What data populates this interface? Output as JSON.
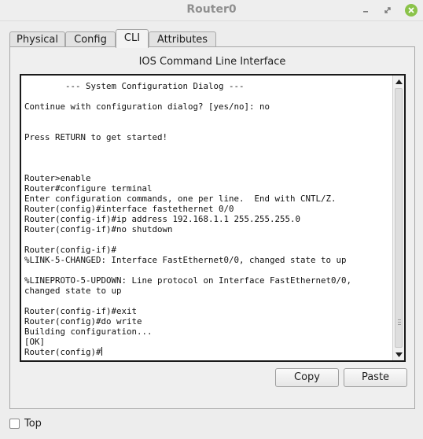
{
  "window": {
    "title": "Router0",
    "controls": [
      "minimize-icon",
      "maximize-icon",
      "close-icon"
    ],
    "close_color": "#8bc34a"
  },
  "tabs": [
    {
      "label": "Physical",
      "active": false
    },
    {
      "label": "Config",
      "active": false
    },
    {
      "label": "CLI",
      "active": true
    },
    {
      "label": "Attributes",
      "active": false
    }
  ],
  "cli": {
    "heading": "IOS Command Line Interface",
    "console_lines": [
      "        --- System Configuration Dialog ---",
      "",
      "Continue with configuration dialog? [yes/no]: no",
      "",
      "",
      "Press RETURN to get started!",
      "",
      "",
      "",
      "Router>enable",
      "Router#configure terminal",
      "Enter configuration commands, one per line.  End with CNTL/Z.",
      "Router(config)#interface fastethernet 0/0",
      "Router(config-if)#ip address 192.168.1.1 255.255.255.0",
      "Router(config-if)#no shutdown",
      "",
      "Router(config-if)#",
      "%LINK-5-CHANGED: Interface FastEthernet0/0, changed state to up",
      "",
      "%LINEPROTO-5-UPDOWN: Line protocol on Interface FastEthernet0/0, changed state to up",
      "",
      "Router(config-if)#exit",
      "Router(config)#do write",
      "Building configuration...",
      "[OK]",
      "Router(config)#"
    ],
    "copy_label": "Copy",
    "paste_label": "Paste"
  },
  "footer": {
    "top_label": "Top",
    "top_checked": false
  }
}
